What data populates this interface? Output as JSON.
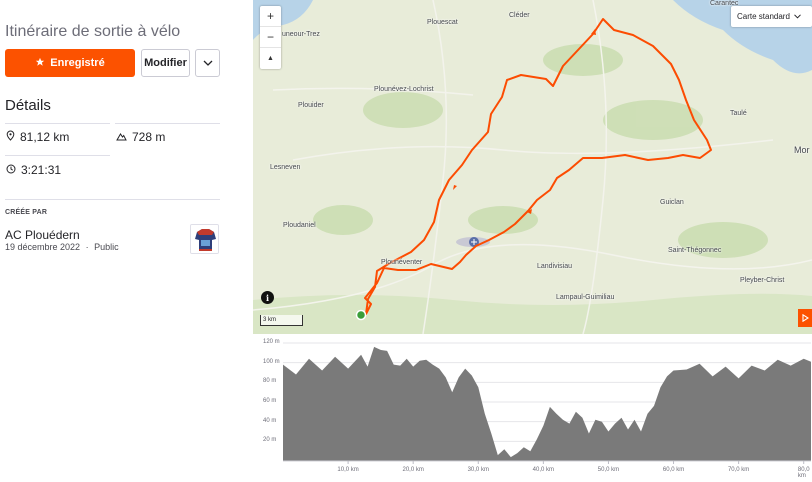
{
  "route": {
    "title": "Itinéraire de sortie à vélo",
    "saved_label": "Enregistré",
    "edit_label": "Modifier",
    "details_heading": "Détails",
    "distance": "81,12 km",
    "elevation": "728 m",
    "duration": "3:21:31",
    "created_by_label": "CRÉÉE PAR",
    "club_name": "AC Plouédern",
    "date": "19 décembre 2022",
    "visibility": "Public",
    "meta_separator": "·"
  },
  "map": {
    "map_type": "Carte standard",
    "zoom_in": "+",
    "zoom_out": "−",
    "compass": "▲",
    "info": "i",
    "scale_label": "3 km",
    "route_color": "#fc4c02",
    "places": {
      "caranted": "Carantec",
      "cleder": "Cléder",
      "plouescat": "Plouescat",
      "plouneour": "uneour-Trez",
      "plounevez": "Plounévez-Lochrist",
      "plouider": "Plouider",
      "taule": "Taulé",
      "morlaix": "Mor",
      "lesneven": "Lesneven",
      "guiclan": "Guiclan",
      "ploudaniel": "Ploudaniel",
      "plouneventer": "Plounéventer",
      "landivisiau": "Landivisiau",
      "stthegonnec": "Saint-Thégonnec",
      "pleyber": "Pleyber-Christ",
      "lampaul": "Lampaul-Guimiliau"
    }
  },
  "elevation_profile": {
    "fill_color": "#7a7a7a",
    "y_ticks": [
      "120 m",
      "100 m",
      "80 m",
      "60 m",
      "40 m",
      "20 m"
    ],
    "x_ticks": [
      "10,0 km",
      "20,0 km",
      "30,0 km",
      "40,0 km",
      "50,0 km",
      "60,0 km",
      "70,0 km",
      "80,0 km"
    ]
  },
  "chart_data": {
    "type": "area",
    "xlabel": "",
    "ylabel": "",
    "ylim": [
      0,
      120
    ],
    "xlim": [
      0,
      81.12
    ],
    "x": [
      0,
      2,
      4,
      6,
      8,
      10,
      12,
      13,
      14,
      15,
      16,
      17,
      18,
      19,
      20,
      21,
      22,
      23,
      24,
      25,
      26,
      27,
      28,
      29,
      30,
      31,
      32,
      33,
      34,
      35,
      36,
      37,
      38,
      39,
      40,
      41,
      42,
      43,
      44,
      45,
      46,
      47,
      48,
      49,
      50,
      51,
      52,
      53,
      54,
      55,
      56,
      57,
      58,
      59,
      60,
      62,
      64,
      66,
      68,
      70,
      72,
      74,
      76,
      78,
      80,
      81.12
    ],
    "y": [
      98,
      88,
      104,
      92,
      106,
      94,
      108,
      96,
      116,
      113,
      112,
      98,
      97,
      104,
      96,
      102,
      103,
      98,
      94,
      85,
      70,
      85,
      94,
      87,
      75,
      48,
      28,
      6,
      12,
      4,
      8,
      14,
      10,
      22,
      36,
      55,
      48,
      42,
      38,
      50,
      44,
      28,
      42,
      40,
      30,
      38,
      44,
      32,
      42,
      30,
      48,
      56,
      75,
      86,
      92,
      93,
      99,
      86,
      96,
      84,
      97,
      92,
      103,
      97,
      104,
      101
    ]
  }
}
